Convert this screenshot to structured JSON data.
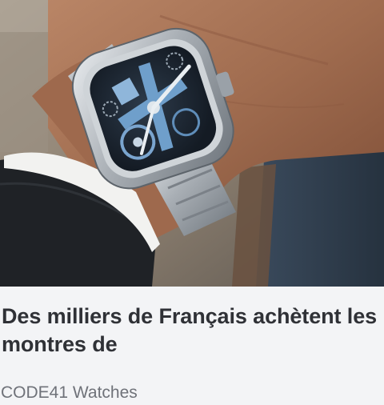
{
  "ad": {
    "image_alt": "Montre squelette bleue CODE41 portée au poignet",
    "headline": "Des milliers de Français achètent les montres de",
    "source": "CODE41 Watches"
  },
  "colors": {
    "background": "#f3f4f6",
    "headline": "#2f3136",
    "source": "#6f7279",
    "dial_blue": "#6f9fcb"
  },
  "icons": {
    "photo": "watch-photo"
  }
}
